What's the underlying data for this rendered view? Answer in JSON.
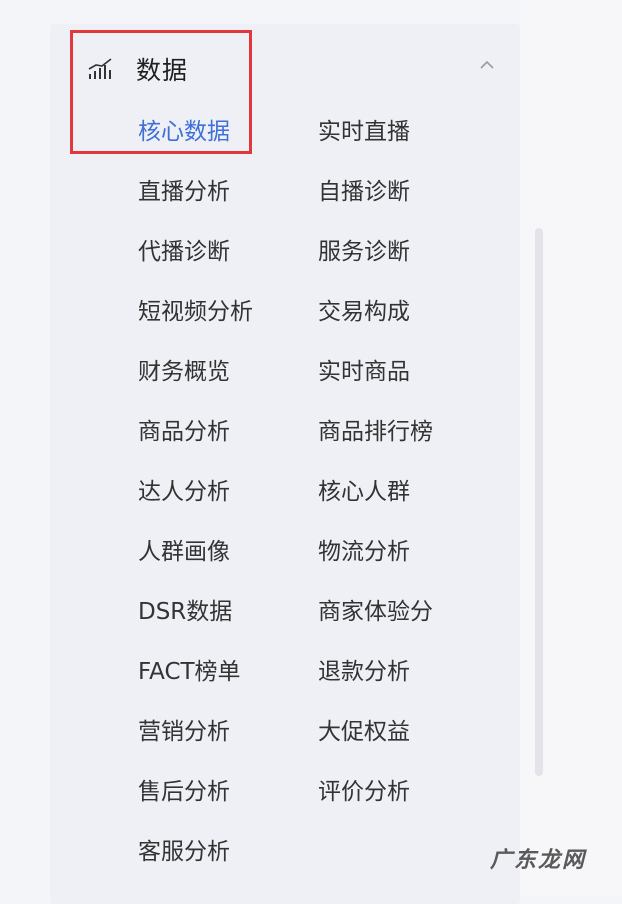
{
  "header": {
    "title": "数据"
  },
  "menu_items": [
    "核心数据",
    "实时直播",
    "直播分析",
    "自播诊断",
    "代播诊断",
    "服务诊断",
    "短视频分析",
    "交易构成",
    "财务概览",
    "实时商品",
    "商品分析",
    "商品排行榜",
    "达人分析",
    "核心人群",
    "人群画像",
    "物流分析",
    "DSR数据",
    "商家体验分",
    "FACT榜单",
    "退款分析",
    "营销分析",
    "大促权益",
    "售后分析",
    "评价分析",
    "客服分析"
  ],
  "active_item": "核心数据",
  "colors": {
    "active": "#3f6fd8",
    "highlight_border": "#e0383b",
    "text": "#333333"
  },
  "icons": {
    "header": "chart-bars-icon",
    "collapse": "chevron-up-icon"
  },
  "watermark": "广东龙网"
}
